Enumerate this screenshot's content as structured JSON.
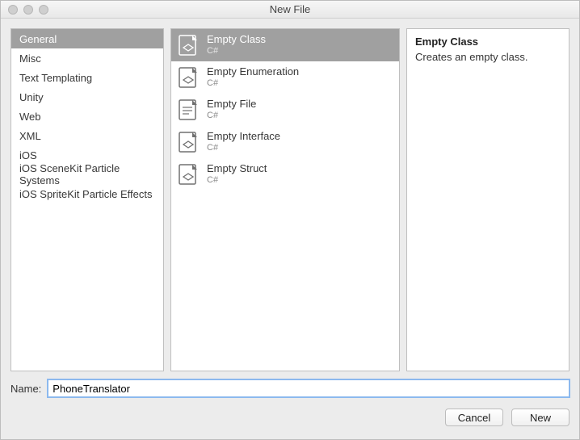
{
  "window": {
    "title": "New File"
  },
  "categories": [
    {
      "label": "General",
      "selected": true
    },
    {
      "label": "Misc"
    },
    {
      "label": "Text Templating"
    },
    {
      "label": "Unity"
    },
    {
      "label": "Web"
    },
    {
      "label": "XML"
    },
    {
      "label": "iOS"
    },
    {
      "label": "iOS SceneKit Particle Systems"
    },
    {
      "label": "iOS SpriteKit Particle Effects"
    }
  ],
  "templates": [
    {
      "name": "Empty Class",
      "sub": "C#",
      "icon": "csharp-class",
      "selected": true
    },
    {
      "name": "Empty Enumeration",
      "sub": "C#",
      "icon": "csharp-enum"
    },
    {
      "name": "Empty File",
      "sub": "C#",
      "icon": "file"
    },
    {
      "name": "Empty Interface",
      "sub": "C#",
      "icon": "csharp-interface"
    },
    {
      "name": "Empty Struct",
      "sub": "C#",
      "icon": "csharp-struct"
    }
  ],
  "details": {
    "title": "Empty Class",
    "description": "Creates an empty class."
  },
  "name_field": {
    "label": "Name:",
    "value": "PhoneTranslator"
  },
  "buttons": {
    "cancel": "Cancel",
    "new": "New"
  }
}
